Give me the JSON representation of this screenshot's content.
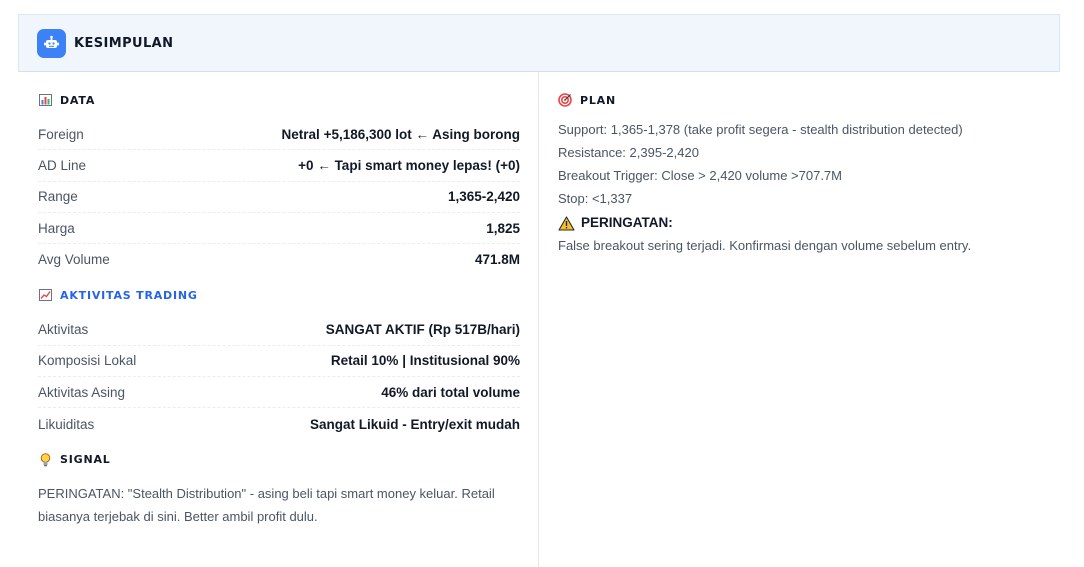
{
  "header": {
    "title": "KESIMPULAN",
    "icon": "robot-icon",
    "accent": "#3b82f6"
  },
  "data_section": {
    "title": "DATA",
    "icon": "bar-chart-icon",
    "rows": [
      {
        "label": "Foreign",
        "value": "Netral +5,186,300 lot ← Asing borong"
      },
      {
        "label": "AD Line",
        "value": "+0 ← Tapi smart money lepas! (+0)"
      },
      {
        "label": "Range",
        "value": "1,365-2,420"
      },
      {
        "label": "Harga",
        "value": "1,825"
      },
      {
        "label": "Avg Volume",
        "value": "471.8M"
      }
    ]
  },
  "trading_section": {
    "title": "AKTIVITAS TRADING",
    "icon": "chart-up-icon",
    "color": "#2563eb",
    "rows": [
      {
        "label": "Aktivitas",
        "value": "SANGAT AKTIF (Rp 517B/hari)"
      },
      {
        "label": "Komposisi Lokal",
        "value": "Retail 10% | Institusional 90%"
      },
      {
        "label": "Aktivitas Asing",
        "value": "46% dari total volume"
      },
      {
        "label": "Likuiditas",
        "value": "Sangat Likuid - Entry/exit mudah"
      }
    ]
  },
  "signal_section": {
    "title": "SIGNAL",
    "icon": "lightbulb-icon",
    "text": "PERINGATAN: \"Stealth Distribution\" - asing beli tapi smart money keluar. Retail biasanya terjebak di sini. Better ambil profit dulu."
  },
  "plan_section": {
    "title": "PLAN",
    "icon": "target-icon",
    "lines": [
      "Support: 1,365-1,378 (take profit segera - stealth distribution detected)",
      "Resistance: 2,395-2,420",
      "Breakout Trigger: Close > 2,420 volume >707.7M",
      "Stop: <1,337"
    ],
    "warning_title": "PERINGATAN:",
    "warning_icon": "warning-icon",
    "warning_text": "False breakout sering terjadi. Konfirmasi dengan volume sebelum entry."
  }
}
